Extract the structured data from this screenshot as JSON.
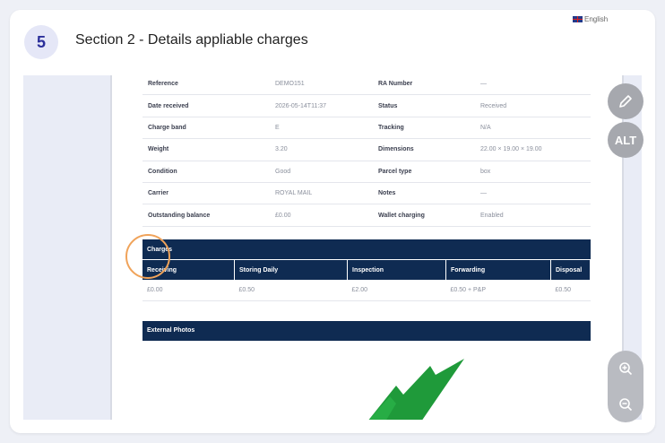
{
  "header": {
    "step_number": "5",
    "title": "Section 2 - Details appliable charges"
  },
  "language": "English",
  "info_rows": [
    {
      "l1": "Reference",
      "v1": "DEMO151",
      "l2": "RA Number",
      "v2": "—"
    },
    {
      "l1": "Date received",
      "v1": "2026-05-14T11:37",
      "l2": "Status",
      "v2": "Received"
    },
    {
      "l1": "Charge band",
      "v1": "E",
      "l2": "Tracking",
      "v2": "N/A"
    },
    {
      "l1": "Weight",
      "v1": "3.20",
      "l2": "Dimensions",
      "v2": "22.00 × 19.00 × 19.00"
    },
    {
      "l1": "Condition",
      "v1": "Good",
      "l2": "Parcel type",
      "v2": "box"
    },
    {
      "l1": "Carrier",
      "v1": "ROYAL MAIL",
      "l2": "Notes",
      "v2": "—"
    },
    {
      "l1": "Outstanding balance",
      "v1": "£0.00",
      "l2": "Wallet charging",
      "v2": "Enabled"
    }
  ],
  "charges": {
    "title": "Charges",
    "columns": [
      "Receiving",
      "Storing Daily",
      "Inspection",
      "Forwarding",
      "Disposal"
    ],
    "values": [
      "£0.00",
      "£0.50",
      "£2.00",
      "£0.50 + P&P",
      "£0.50"
    ]
  },
  "external_photos": {
    "title": "External Photos"
  },
  "buttons": {
    "alt_label": "ALT"
  },
  "colors": {
    "navy_header": "#0f2b52",
    "badge_bg": "#e5e7f7",
    "badge_text": "#2b2f9a",
    "leaf_green": "#1f9a3a",
    "cursor_ring": "#f0a35a"
  }
}
